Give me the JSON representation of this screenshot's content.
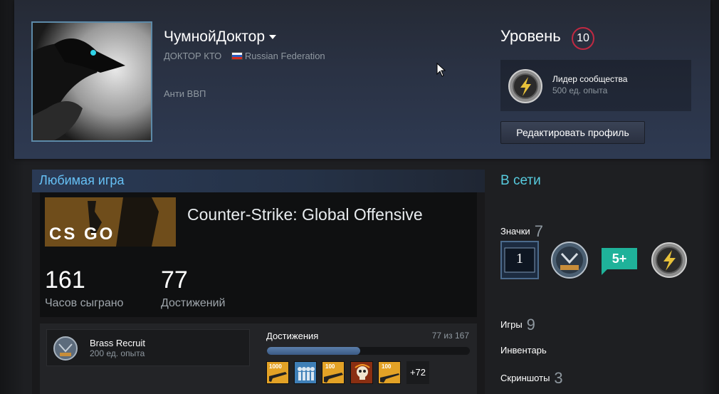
{
  "profile": {
    "persona_name": "ЧумнойДоктор",
    "real_name": "ДОКТОР КТО",
    "country": "Russian Federation",
    "summary": "Анти ВВП"
  },
  "level": {
    "label": "Уровень",
    "value": "10"
  },
  "favorite_badge": {
    "name": "Лидер сообщества",
    "xp": "500 ед. опыта"
  },
  "edit_profile_label": "Редактировать профиль",
  "favorite_game": {
    "section_title": "Любимая игра",
    "title": "Counter-Strike: Global Offensive",
    "capsule_text": "CS GO",
    "hours": "161",
    "hours_label": "Часов сыграно",
    "achievements": "77",
    "achievements_label": "Достижений"
  },
  "rank": {
    "name": "Brass Recruit",
    "xp": "200 ед. опыта"
  },
  "achievement_progress": {
    "label": "Достижения",
    "count_text": "77 из 167",
    "fraction": 0.461,
    "icon_labels": [
      "1000",
      "",
      "100",
      "",
      "100"
    ],
    "more": "+72"
  },
  "sidebar": {
    "status": "В сети",
    "badges_label": "Значки",
    "badges_count": "7",
    "badge_one_text": "1",
    "badge_five_text": "5+",
    "games_label": "Игры",
    "games_count": "9",
    "inventory_label": "Инвентарь",
    "screenshots_label": "Скриншоты",
    "screenshots_count": "3"
  },
  "colors": {
    "accent_blue": "#66c0f4",
    "online": "#57cbde",
    "level_ring": "#c02942"
  }
}
